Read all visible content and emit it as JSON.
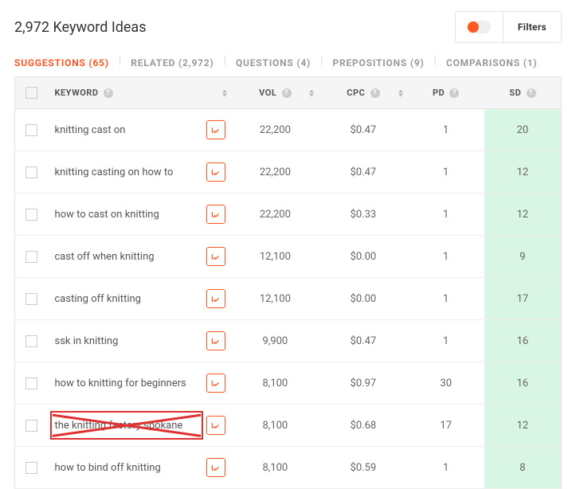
{
  "header": {
    "title": "2,972 Keyword Ideas",
    "filters": "Filters"
  },
  "tabs": [
    {
      "label": "SUGGESTIONS (65)",
      "active": true
    },
    {
      "label": "RELATED (2,972)",
      "active": false
    },
    {
      "label": "QUESTIONS (4)",
      "active": false
    },
    {
      "label": "PREPOSITIONS (9)",
      "active": false
    },
    {
      "label": "COMPARISONS (1)",
      "active": false
    }
  ],
  "columns": {
    "keyword": "KEYWORD",
    "vol": "VOL",
    "cpc": "CPC",
    "pd": "PD",
    "sd": "SD"
  },
  "rows": [
    {
      "keyword": "knitting cast on",
      "vol": "22,200",
      "cpc": "$0.47",
      "pd": "1",
      "sd": "20",
      "crossed": false
    },
    {
      "keyword": "knitting casting on how to",
      "vol": "22,200",
      "cpc": "$0.47",
      "pd": "1",
      "sd": "12",
      "crossed": false
    },
    {
      "keyword": "how to cast on knitting",
      "vol": "22,200",
      "cpc": "$0.33",
      "pd": "1",
      "sd": "12",
      "crossed": false
    },
    {
      "keyword": "cast off when knitting",
      "vol": "12,100",
      "cpc": "$0.00",
      "pd": "1",
      "sd": "9",
      "crossed": false
    },
    {
      "keyword": "casting off knitting",
      "vol": "12,100",
      "cpc": "$0.00",
      "pd": "1",
      "sd": "17",
      "crossed": false
    },
    {
      "keyword": "ssk in knitting",
      "vol": "9,900",
      "cpc": "$0.47",
      "pd": "1",
      "sd": "16",
      "crossed": false
    },
    {
      "keyword": "how to knitting for beginners",
      "vol": "8,100",
      "cpc": "$0.97",
      "pd": "30",
      "sd": "16",
      "crossed": false
    },
    {
      "keyword": "the knitting factory spokane",
      "vol": "8,100",
      "cpc": "$0.68",
      "pd": "17",
      "sd": "12",
      "crossed": true
    },
    {
      "keyword": "how to bind off knitting",
      "vol": "8,100",
      "cpc": "$0.59",
      "pd": "1",
      "sd": "8",
      "crossed": false
    }
  ]
}
